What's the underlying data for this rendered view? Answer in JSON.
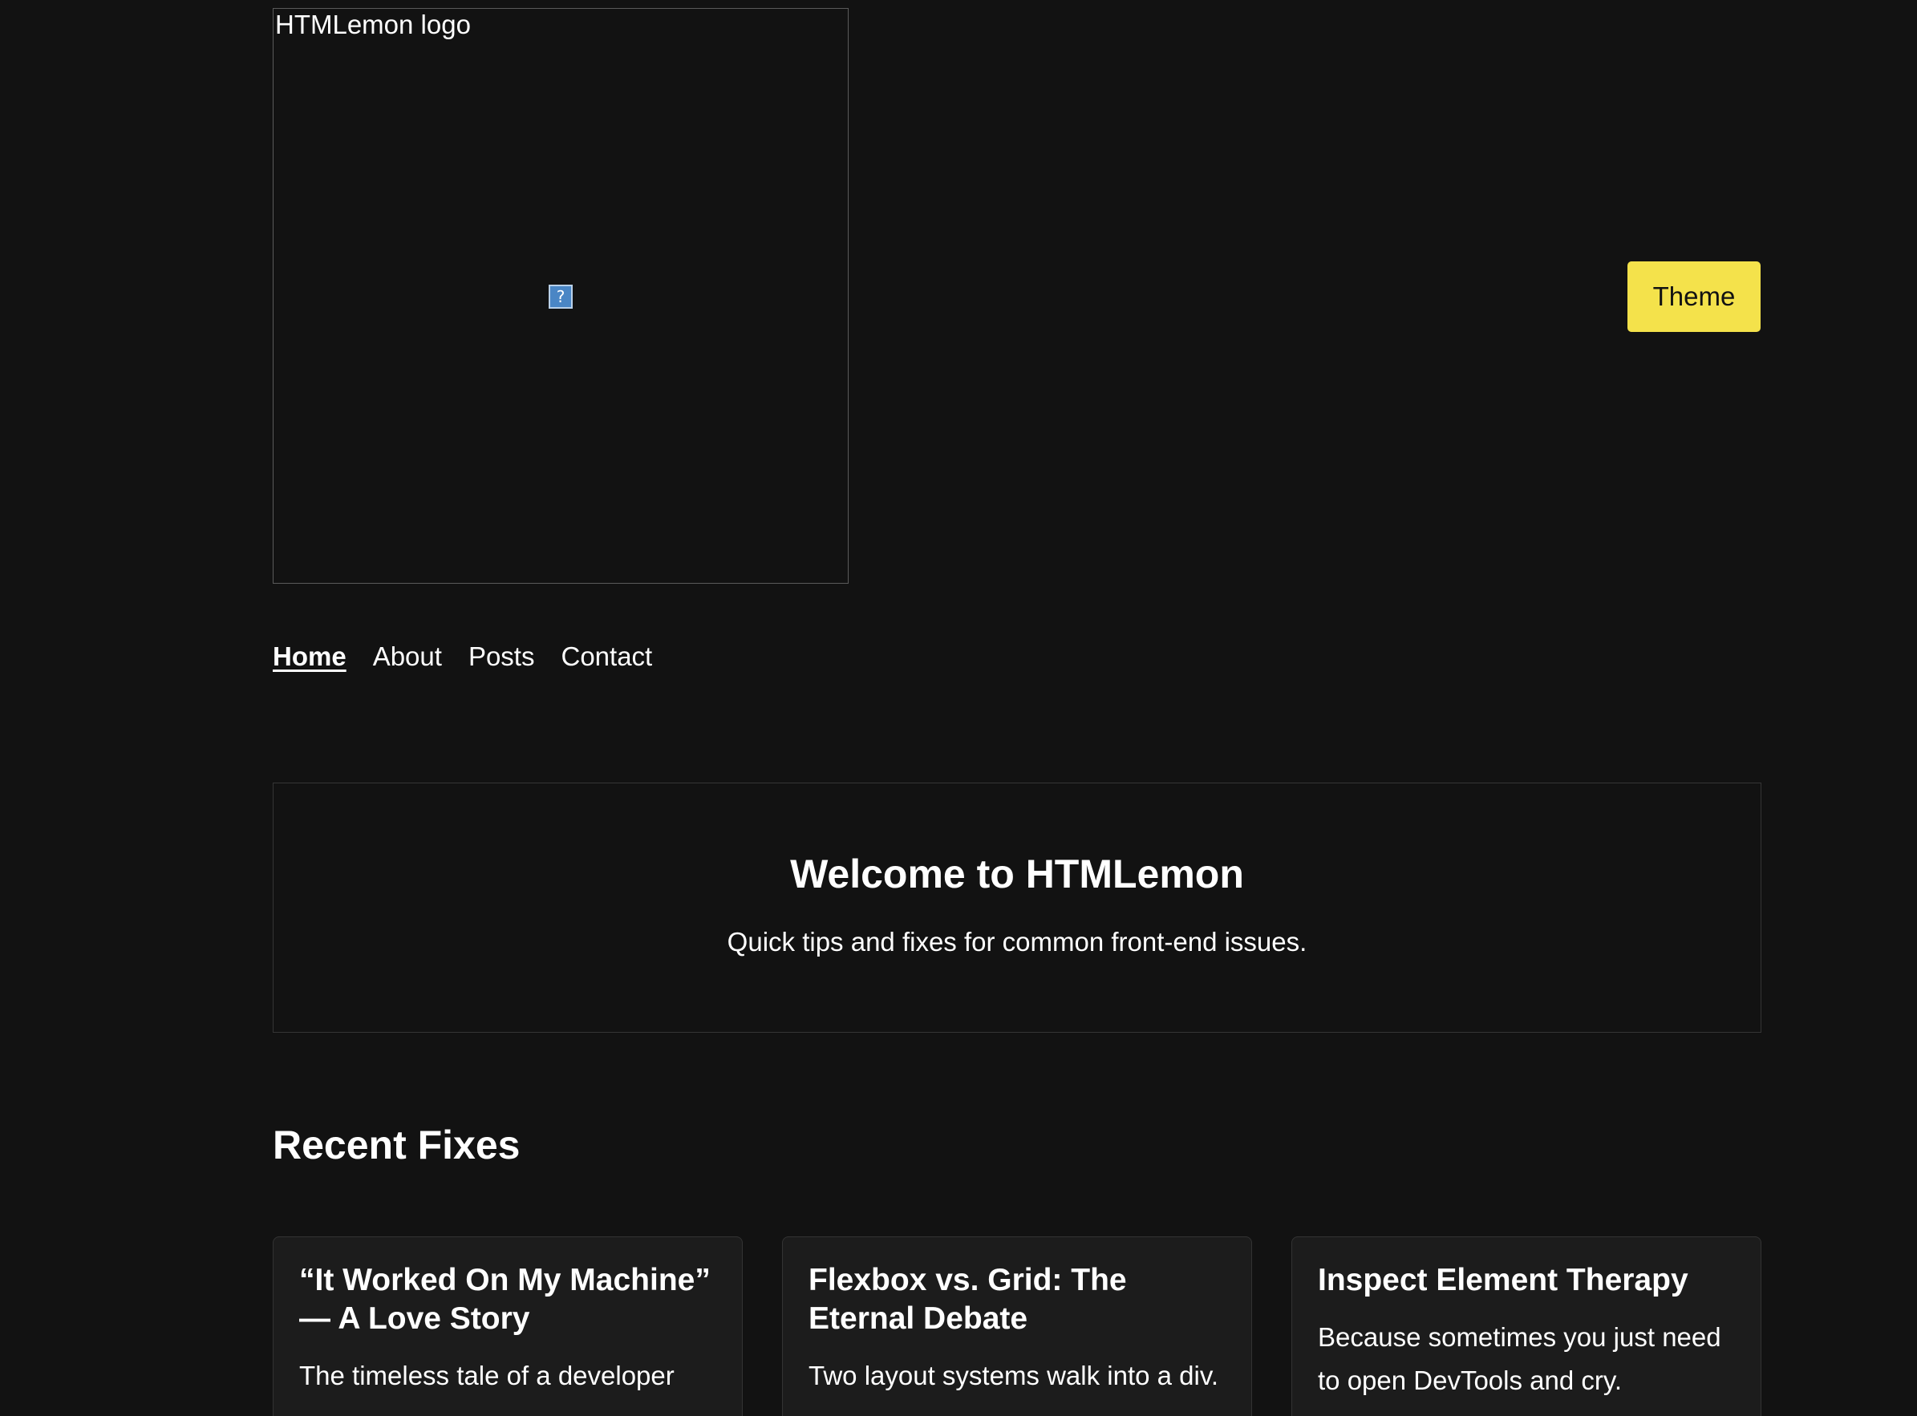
{
  "header": {
    "logo_alt": "HTMLemon logo",
    "broken_image_glyph": "?",
    "theme_button_label": "Theme"
  },
  "nav": {
    "items": [
      {
        "label": "Home",
        "active": true
      },
      {
        "label": "About",
        "active": false
      },
      {
        "label": "Posts",
        "active": false
      },
      {
        "label": "Contact",
        "active": false
      }
    ]
  },
  "hero": {
    "title": "Welcome to HTMLemon",
    "subtitle": "Quick tips and fixes for common front-end issues."
  },
  "recent": {
    "heading": "Recent Fixes",
    "cards": [
      {
        "title": "“It Worked On My Machine” — A Love Story",
        "excerpt": "The timeless tale of a developer"
      },
      {
        "title": "Flexbox vs. Grid: The Eternal Debate",
        "excerpt": "Two layout systems walk into a div."
      },
      {
        "title": "Inspect Element Therapy",
        "excerpt": "Because sometimes you just need to open DevTools and cry."
      }
    ]
  },
  "colors": {
    "background": "#121212",
    "card_background": "#1c1c1c",
    "accent": "#f4e24b",
    "text": "#ffffff"
  }
}
